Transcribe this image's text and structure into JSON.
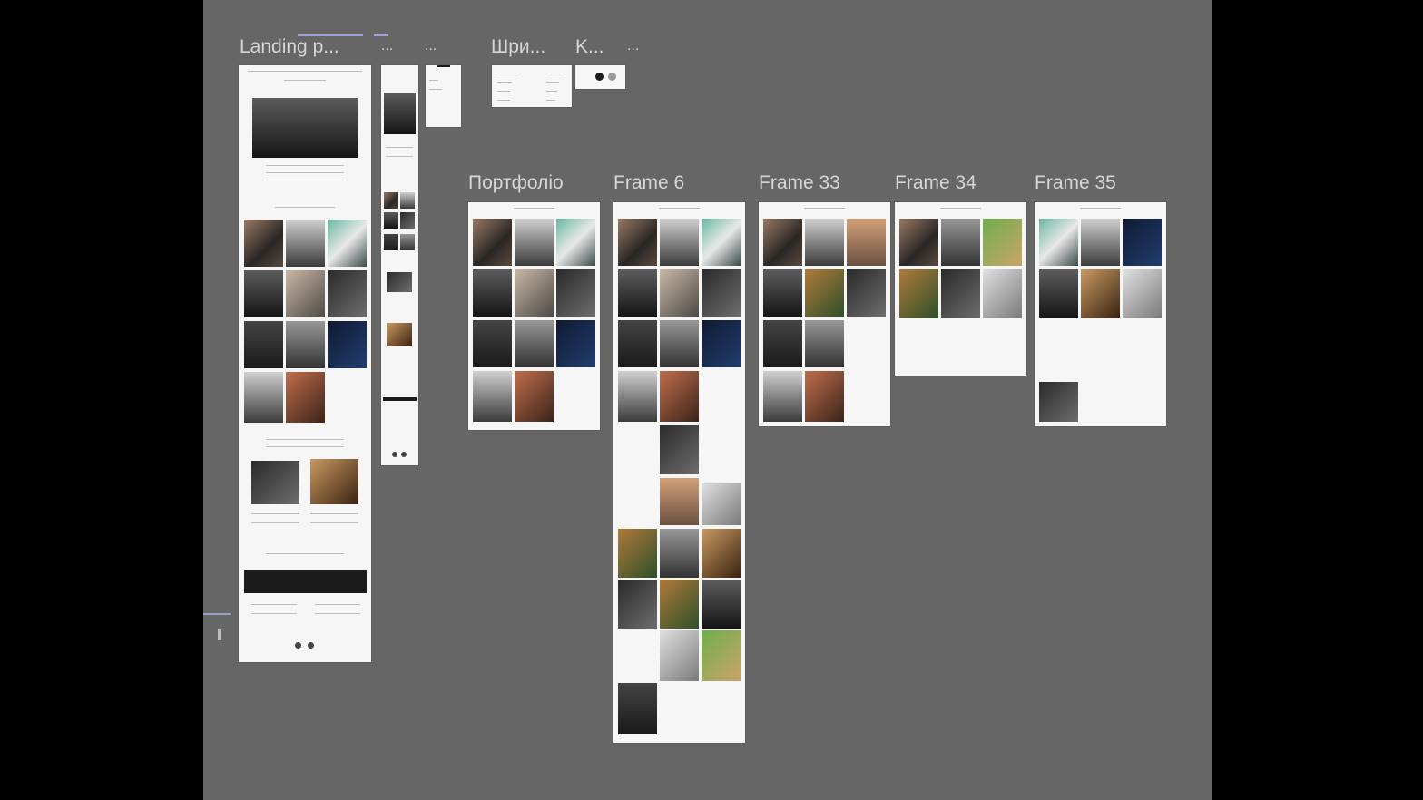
{
  "canvas": {
    "background": "#666666"
  },
  "labels": {
    "landing": "Landing p...",
    "dots_a": "...",
    "dots_b": "...",
    "fonts": "Шри...",
    "k": "K...",
    "dots_c": "...",
    "portfolio": "Портфоліо",
    "frame6": "Frame 6",
    "frame33": "Frame 33",
    "frame34": "Frame 34",
    "frame35": "Frame 35"
  },
  "colors": {
    "swatch_dark": "#1c1c1c",
    "swatch_grey": "#9a9a9a"
  }
}
